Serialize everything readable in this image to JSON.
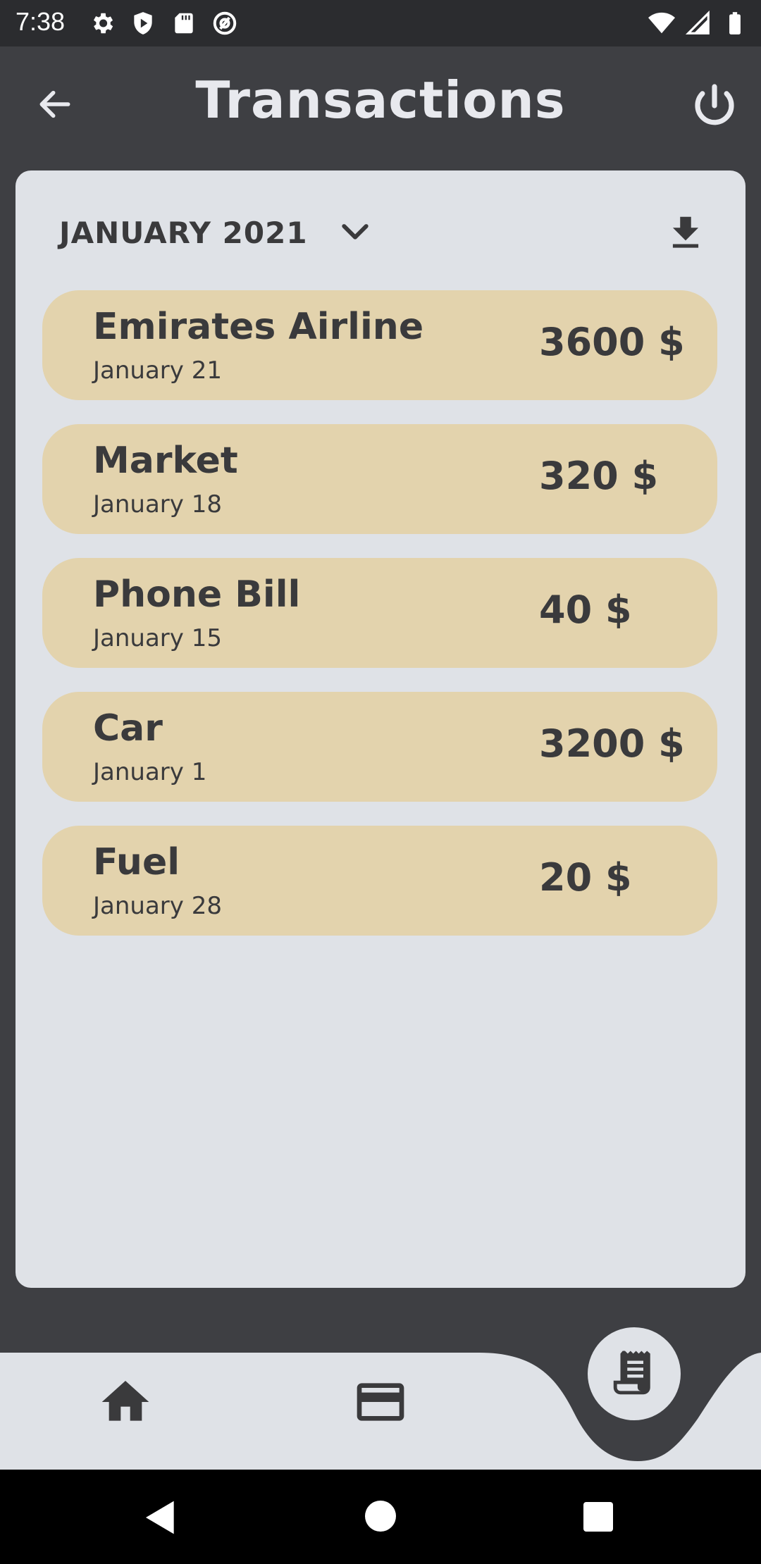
{
  "status_bar": {
    "time": "7:38",
    "left_icons": [
      "gear-icon",
      "shield-icon",
      "sd-card-icon",
      "at-icon"
    ],
    "right_icons": [
      "wifi-icon",
      "signal-icon",
      "battery-icon"
    ]
  },
  "header": {
    "title": "Transactions",
    "back_icon": "arrow-left-icon",
    "power_icon": "power-icon"
  },
  "filter": {
    "month": "JANUARY 2021",
    "dropdown_icon": "chevron-down-icon",
    "download_icon": "download-icon"
  },
  "transactions": [
    {
      "name": "Emirates Airline",
      "date": "January 21",
      "amount": "3600 $"
    },
    {
      "name": "Market",
      "date": "January 18",
      "amount": "320 $"
    },
    {
      "name": "Phone Bill",
      "date": "January 15",
      "amount": "40 $"
    },
    {
      "name": "Car",
      "date": "January 1",
      "amount": "3200 $"
    },
    {
      "name": "Fuel",
      "date": "January 28",
      "amount": "20 $"
    }
  ],
  "bottom_nav": {
    "items": [
      "home-icon",
      "credit-card-icon",
      "receipt-icon"
    ],
    "active": "receipt-icon"
  },
  "colors": {
    "background": "#3e3f43",
    "card": "#dfe2e7",
    "transaction_item": "#e3d3ad",
    "text_dark": "#3a3a3c",
    "title": "#e8e9ee"
  }
}
